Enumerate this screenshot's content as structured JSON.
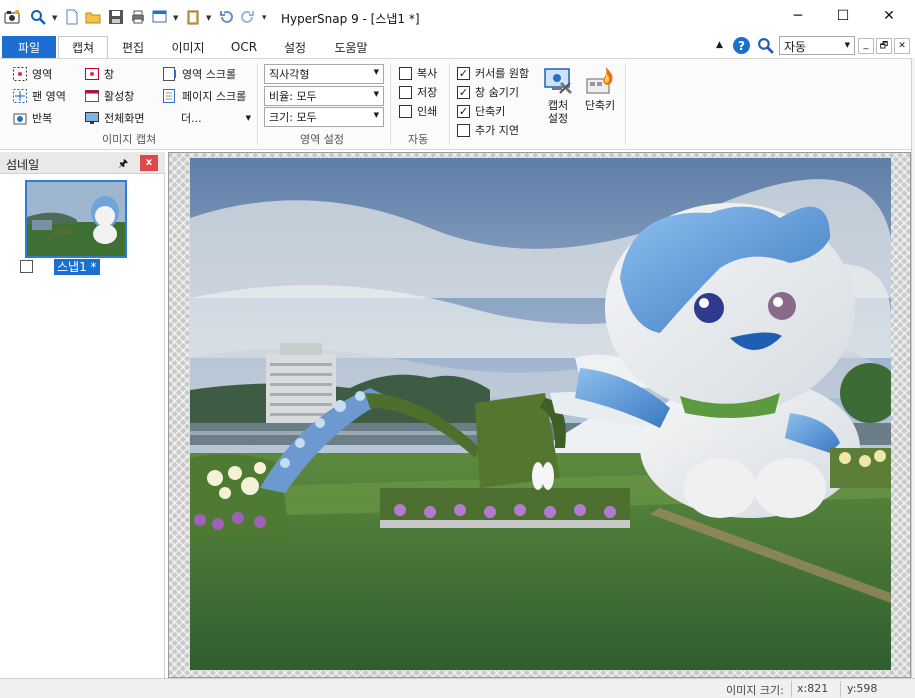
{
  "window": {
    "title": "HyperSnap 9 - [스냅1 *]",
    "minimize_glyph": "─",
    "maximize_glyph": "☐",
    "close_glyph": "✕"
  },
  "quick_access": {
    "icons": [
      "camera-app-icon",
      "zoom-icon",
      "new-file-icon",
      "open-folder-icon",
      "save-icon",
      "print-icon",
      "window-capture-icon",
      "clipboard-icon",
      "undo-icon",
      "redo-icon",
      "customize-arrow-icon"
    ]
  },
  "tabs": [
    {
      "label": "파일"
    },
    {
      "label": "캡쳐"
    },
    {
      "label": "편집"
    },
    {
      "label": "이미지"
    },
    {
      "label": "OCR"
    },
    {
      "label": "설정"
    },
    {
      "label": "도움말"
    }
  ],
  "tab_right": {
    "zoom_value": "자동",
    "up_glyph": "▲",
    "help_glyph": "?",
    "mini_min": "_",
    "mini_restore": "🗗",
    "mini_close": "✕"
  },
  "ribbon": {
    "capture_group": {
      "label": "이미지 캡쳐",
      "region": "영역",
      "pan_region": "팬 영역",
      "repeat": "반복",
      "window": "창",
      "active_window": "활성창",
      "full_screen": "전체화면",
      "scroll_region": "영역 스크롤",
      "scroll_page": "페이지 스크롤",
      "more": "더..."
    },
    "region_settings": {
      "label": "영역 설정",
      "shape": "직사각형",
      "ratio": "비율: 모두",
      "size": "크기: 모두"
    },
    "auto_group": {
      "label": "자동",
      "copy": "복사",
      "save": "저장",
      "print": "인쇄"
    },
    "options_group": {
      "cursor": "커서를 원함",
      "hide_window": "창 숨기기",
      "hotkey": "단축키",
      "add_delay": "추가 지연",
      "capture_settings": [
        "캡처",
        "설정"
      ],
      "hotkeys_big": "단축키"
    },
    "checks": {
      "copy": false,
      "save": false,
      "print": false,
      "cursor": true,
      "hide_window": true,
      "hotkey": true,
      "add_delay": false
    }
  },
  "thumb_panel": {
    "title": "섬네일",
    "pin_glyph": "🖈",
    "close_glyph": "x",
    "item_label": "스냅1 *"
  },
  "status": {
    "image_size_label": "이미지 크기:",
    "x": "x:821",
    "y": "y:598"
  },
  "colors": {
    "accent": "#1a6fd1",
    "close_red": "#e04848"
  }
}
